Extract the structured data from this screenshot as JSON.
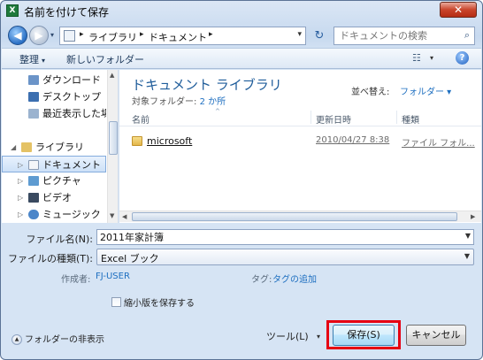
{
  "window": {
    "title": "名前を付けて保存",
    "app_icon_glyph": "X",
    "close_glyph": "✕"
  },
  "address": {
    "crumbs": [
      "ライブラリ",
      "ドキュメント"
    ],
    "separator": "▸",
    "dropdown": "▾",
    "refresh_glyph": "↻",
    "history_glyph": "▾"
  },
  "search": {
    "placeholder": "ドキュメントの検索",
    "icon": "search-icon"
  },
  "toolbar": {
    "organize": "整理",
    "arrow": "▾",
    "new_folder": "新しいフォルダー",
    "view_glyph": "☷",
    "help_glyph": "?"
  },
  "nav": {
    "items": [
      {
        "label": "ダウンロード",
        "icon": "download-folder-icon",
        "expander": ""
      },
      {
        "label": "デスクトップ",
        "icon": "desktop-icon",
        "expander": ""
      },
      {
        "label": "最近表示した場所",
        "icon": "recent-places-icon",
        "expander": ""
      },
      {
        "label": "ライブラリ",
        "icon": "library-icon",
        "expander": "◢"
      },
      {
        "label": "ドキュメント",
        "icon": "documents-icon",
        "expander": "▷",
        "selected": true
      },
      {
        "label": "ピクチャ",
        "icon": "pictures-icon",
        "expander": "▷"
      },
      {
        "label": "ビデオ",
        "icon": "videos-icon",
        "expander": "▷"
      },
      {
        "label": "ミュージック",
        "icon": "music-icon",
        "expander": "▷"
      }
    ]
  },
  "main": {
    "title": "ドキュメント ライブラリ",
    "subtitle_prefix": "対象フォルダー: ",
    "subtitle_link": "2 か所",
    "arrange_label": "並べ替え:",
    "arrange_value": "フォルダー ▾",
    "columns": [
      "名前",
      "更新日時",
      "種類"
    ],
    "sort_glyph": "^",
    "rows": [
      {
        "name": "microsoft",
        "date": "2010/04/27 8:38",
        "type": "ファイル フォル..."
      }
    ]
  },
  "form": {
    "filename_label": "ファイル名(N):",
    "filename_value": "2011年家計簿",
    "filetype_label": "ファイルの種類(T):",
    "filetype_value": "Excel ブック",
    "author_label": "作成者:",
    "author_value": "FJ-USER",
    "tag_label": "タグ:",
    "tag_value": "タグの追加",
    "thumbnail_label": "縮小版を保存する"
  },
  "bottom": {
    "hide_folders": "フォルダーの非表示",
    "hide_glyph": "▲",
    "tools": "ツール(L)",
    "tools_drop": "▾",
    "save": "保存(S)",
    "cancel": "キャンセル"
  },
  "colors": {
    "highlight": "#e60012",
    "link": "#1e6fc0",
    "title_blue": "#1e5c9a"
  }
}
